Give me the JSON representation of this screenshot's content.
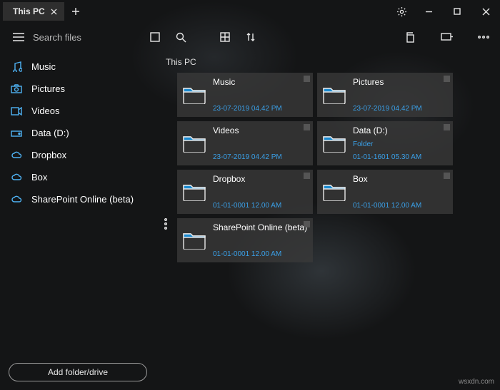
{
  "title_tab": "This PC",
  "search_placeholder": "Search files",
  "breadcrumb": "This PC",
  "sidebar": {
    "items": [
      {
        "label": "Music",
        "icon": "music-icon"
      },
      {
        "label": "Pictures",
        "icon": "camera-icon"
      },
      {
        "label": "Videos",
        "icon": "video-icon"
      },
      {
        "label": "Data (D:)",
        "icon": "drive-icon"
      },
      {
        "label": "Dropbox",
        "icon": "cloud-icon"
      },
      {
        "label": "Box",
        "icon": "cloud-icon"
      },
      {
        "label": "SharePoint Online (beta)",
        "icon": "cloud-icon"
      }
    ],
    "add_button": "Add folder/drive"
  },
  "tiles": [
    {
      "name": "Music",
      "sub": "",
      "date": "23-07-2019 04.42 PM"
    },
    {
      "name": "Pictures",
      "sub": "",
      "date": "23-07-2019 04.42 PM"
    },
    {
      "name": "Videos",
      "sub": "",
      "date": "23-07-2019 04.42 PM"
    },
    {
      "name": "Data (D:)",
      "sub": "Folder",
      "date": "01-01-1601 05.30 AM"
    },
    {
      "name": "Dropbox",
      "sub": "",
      "date": "01-01-0001 12.00 AM"
    },
    {
      "name": "Box",
      "sub": "",
      "date": "01-01-0001 12.00 AM"
    },
    {
      "name": "SharePoint Online (beta)",
      "sub": "",
      "date": "01-01-0001 12.00 AM"
    }
  ],
  "watermark": "wsxdn.com"
}
